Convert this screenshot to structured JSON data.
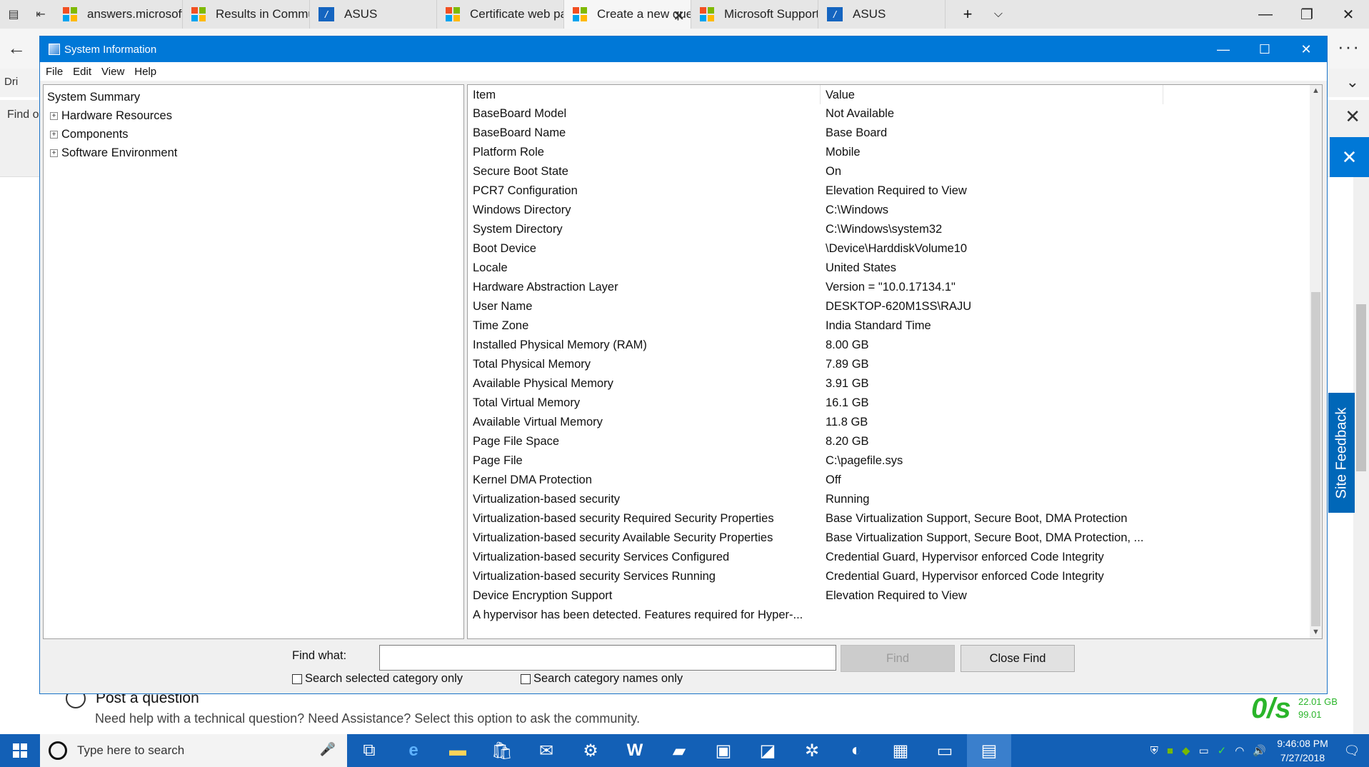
{
  "browser": {
    "tabs": [
      {
        "label": "answers.microsoft.com",
        "icon": "microsoft-icon",
        "active": false
      },
      {
        "label": "Results in Community F",
        "icon": "microsoft-icon",
        "active": false
      },
      {
        "label": "ASUS",
        "icon": "asus-icon",
        "active": false
      },
      {
        "label": "Certificate web page e›",
        "icon": "microsoft-icon",
        "active": false
      },
      {
        "label": "Create a new quest",
        "icon": "microsoft-icon",
        "active": true
      },
      {
        "label": "Microsoft Support Tech",
        "icon": "microsoft-icon",
        "active": false
      },
      {
        "label": "ASUS",
        "icon": "asus-icon",
        "active": false
      }
    ],
    "behind_text_dri": "Dri",
    "behind_text_find": "Find o"
  },
  "window": {
    "title": "System Information",
    "menu": [
      "File",
      "Edit",
      "View",
      "Help"
    ]
  },
  "tree": {
    "root": "System Summary",
    "children": [
      "Hardware Resources",
      "Components",
      "Software Environment"
    ]
  },
  "table": {
    "headers": [
      "Item",
      "Value"
    ],
    "rows": [
      [
        "BaseBoard Model",
        "Not Available"
      ],
      [
        "BaseBoard Name",
        "Base Board"
      ],
      [
        "Platform Role",
        "Mobile"
      ],
      [
        "Secure Boot State",
        "On"
      ],
      [
        "PCR7 Configuration",
        "Elevation Required to View"
      ],
      [
        "Windows Directory",
        "C:\\Windows"
      ],
      [
        "System Directory",
        "C:\\Windows\\system32"
      ],
      [
        "Boot Device",
        "\\Device\\HarddiskVolume10"
      ],
      [
        "Locale",
        "United States"
      ],
      [
        "Hardware Abstraction Layer",
        "Version = \"10.0.17134.1\""
      ],
      [
        "User Name",
        "DESKTOP-620M1SS\\RAJU"
      ],
      [
        "Time Zone",
        "India Standard Time"
      ],
      [
        "Installed Physical Memory (RAM)",
        "8.00 GB"
      ],
      [
        "Total Physical Memory",
        "7.89 GB"
      ],
      [
        "Available Physical Memory",
        "3.91 GB"
      ],
      [
        "Total Virtual Memory",
        "16.1 GB"
      ],
      [
        "Available Virtual Memory",
        "11.8 GB"
      ],
      [
        "Page File Space",
        "8.20 GB"
      ],
      [
        "Page File",
        "C:\\pagefile.sys"
      ],
      [
        "Kernel DMA Protection",
        "Off"
      ],
      [
        "Virtualization-based security",
        "Running"
      ],
      [
        "Virtualization-based security Required Security Properties",
        "Base Virtualization Support, Secure Boot, DMA Protection"
      ],
      [
        "Virtualization-based security Available Security Properties",
        "Base Virtualization Support, Secure Boot, DMA Protection, ..."
      ],
      [
        "Virtualization-based security Services Configured",
        "Credential Guard, Hypervisor enforced Code Integrity"
      ],
      [
        "Virtualization-based security Services Running",
        "Credential Guard, Hypervisor enforced Code Integrity"
      ],
      [
        "Device Encryption Support",
        "Elevation Required to View"
      ],
      [
        "A hypervisor has been detected. Features required for Hyper-...",
        ""
      ]
    ]
  },
  "find": {
    "label": "Find what:",
    "value": "",
    "find_button": "Find",
    "close_button": "Close Find",
    "check_selected": "Search selected category only",
    "check_names": "Search category names only"
  },
  "page": {
    "site_feedback": "Site Feedback",
    "post_question": "Post a question",
    "post_question_sub": "Need help with a technical question? Need Assistance? Select this option to ask the community.",
    "speed_value": "0/s",
    "speed_total": "22.01 GB",
    "speed_sub": "99.01"
  },
  "taskbar": {
    "search_placeholder": "Type here to search",
    "time": "9:46:08 PM",
    "date": "7/27/2018"
  },
  "colors": {
    "title_bar": "#0078d7",
    "taskbar": "#1360b6",
    "accent_green": "#2ab52a"
  }
}
